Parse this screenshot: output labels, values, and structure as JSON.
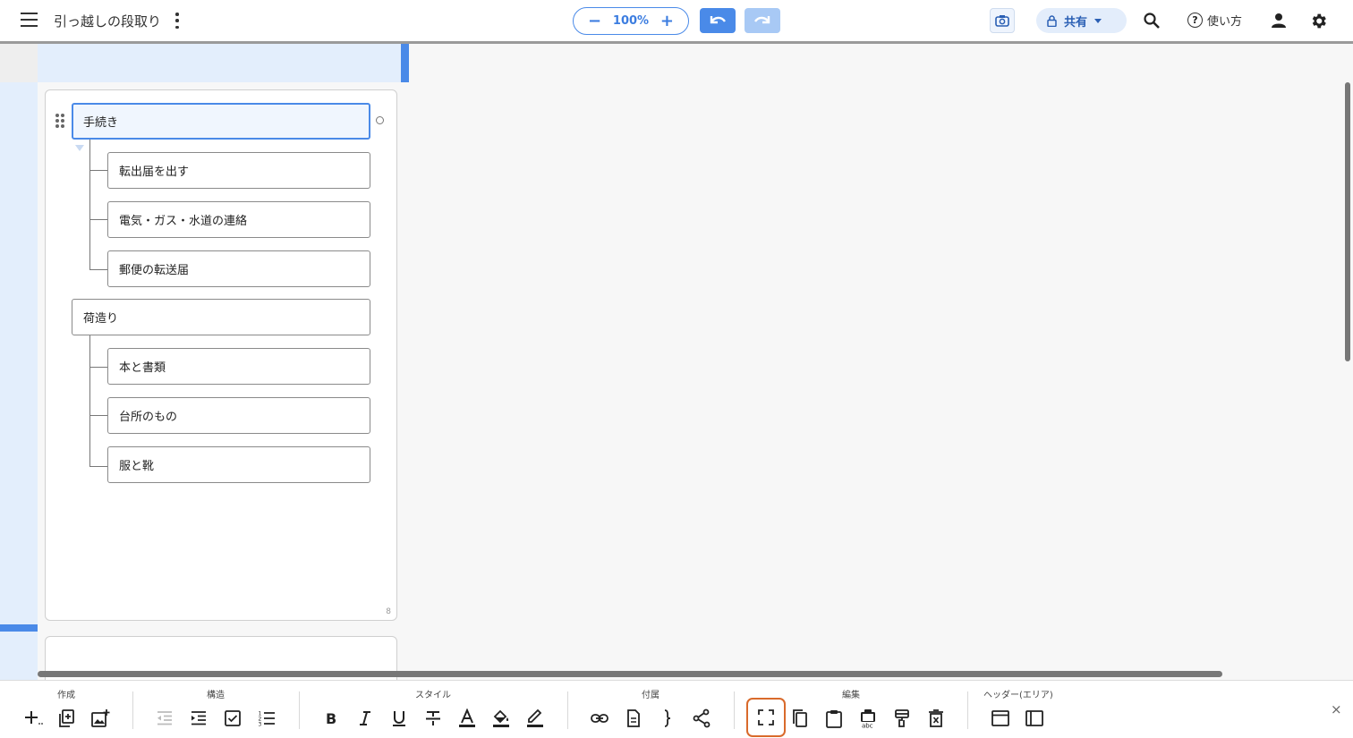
{
  "header": {
    "title": "引っ越しの段取り",
    "zoom": "100%",
    "zoom_out": "−",
    "zoom_in": "+",
    "share_label": "共有",
    "help_label": "使い方"
  },
  "card": {
    "count": "8",
    "nodes": [
      "手続き",
      "転出届を出す",
      "電気・ガス・水道の連絡",
      "郵便の転送届",
      "荷造り",
      "本と書類",
      "台所のもの",
      "服と靴"
    ]
  },
  "toolbar": {
    "groups": [
      "作成",
      "構造",
      "スタイル",
      "付属",
      "編集",
      "ヘッダー(エリア)"
    ],
    "close": "×"
  },
  "colors": {
    "accent": "#4a8ae8",
    "highlight": "#d96a2b",
    "area_tint": "#e3eefc"
  }
}
